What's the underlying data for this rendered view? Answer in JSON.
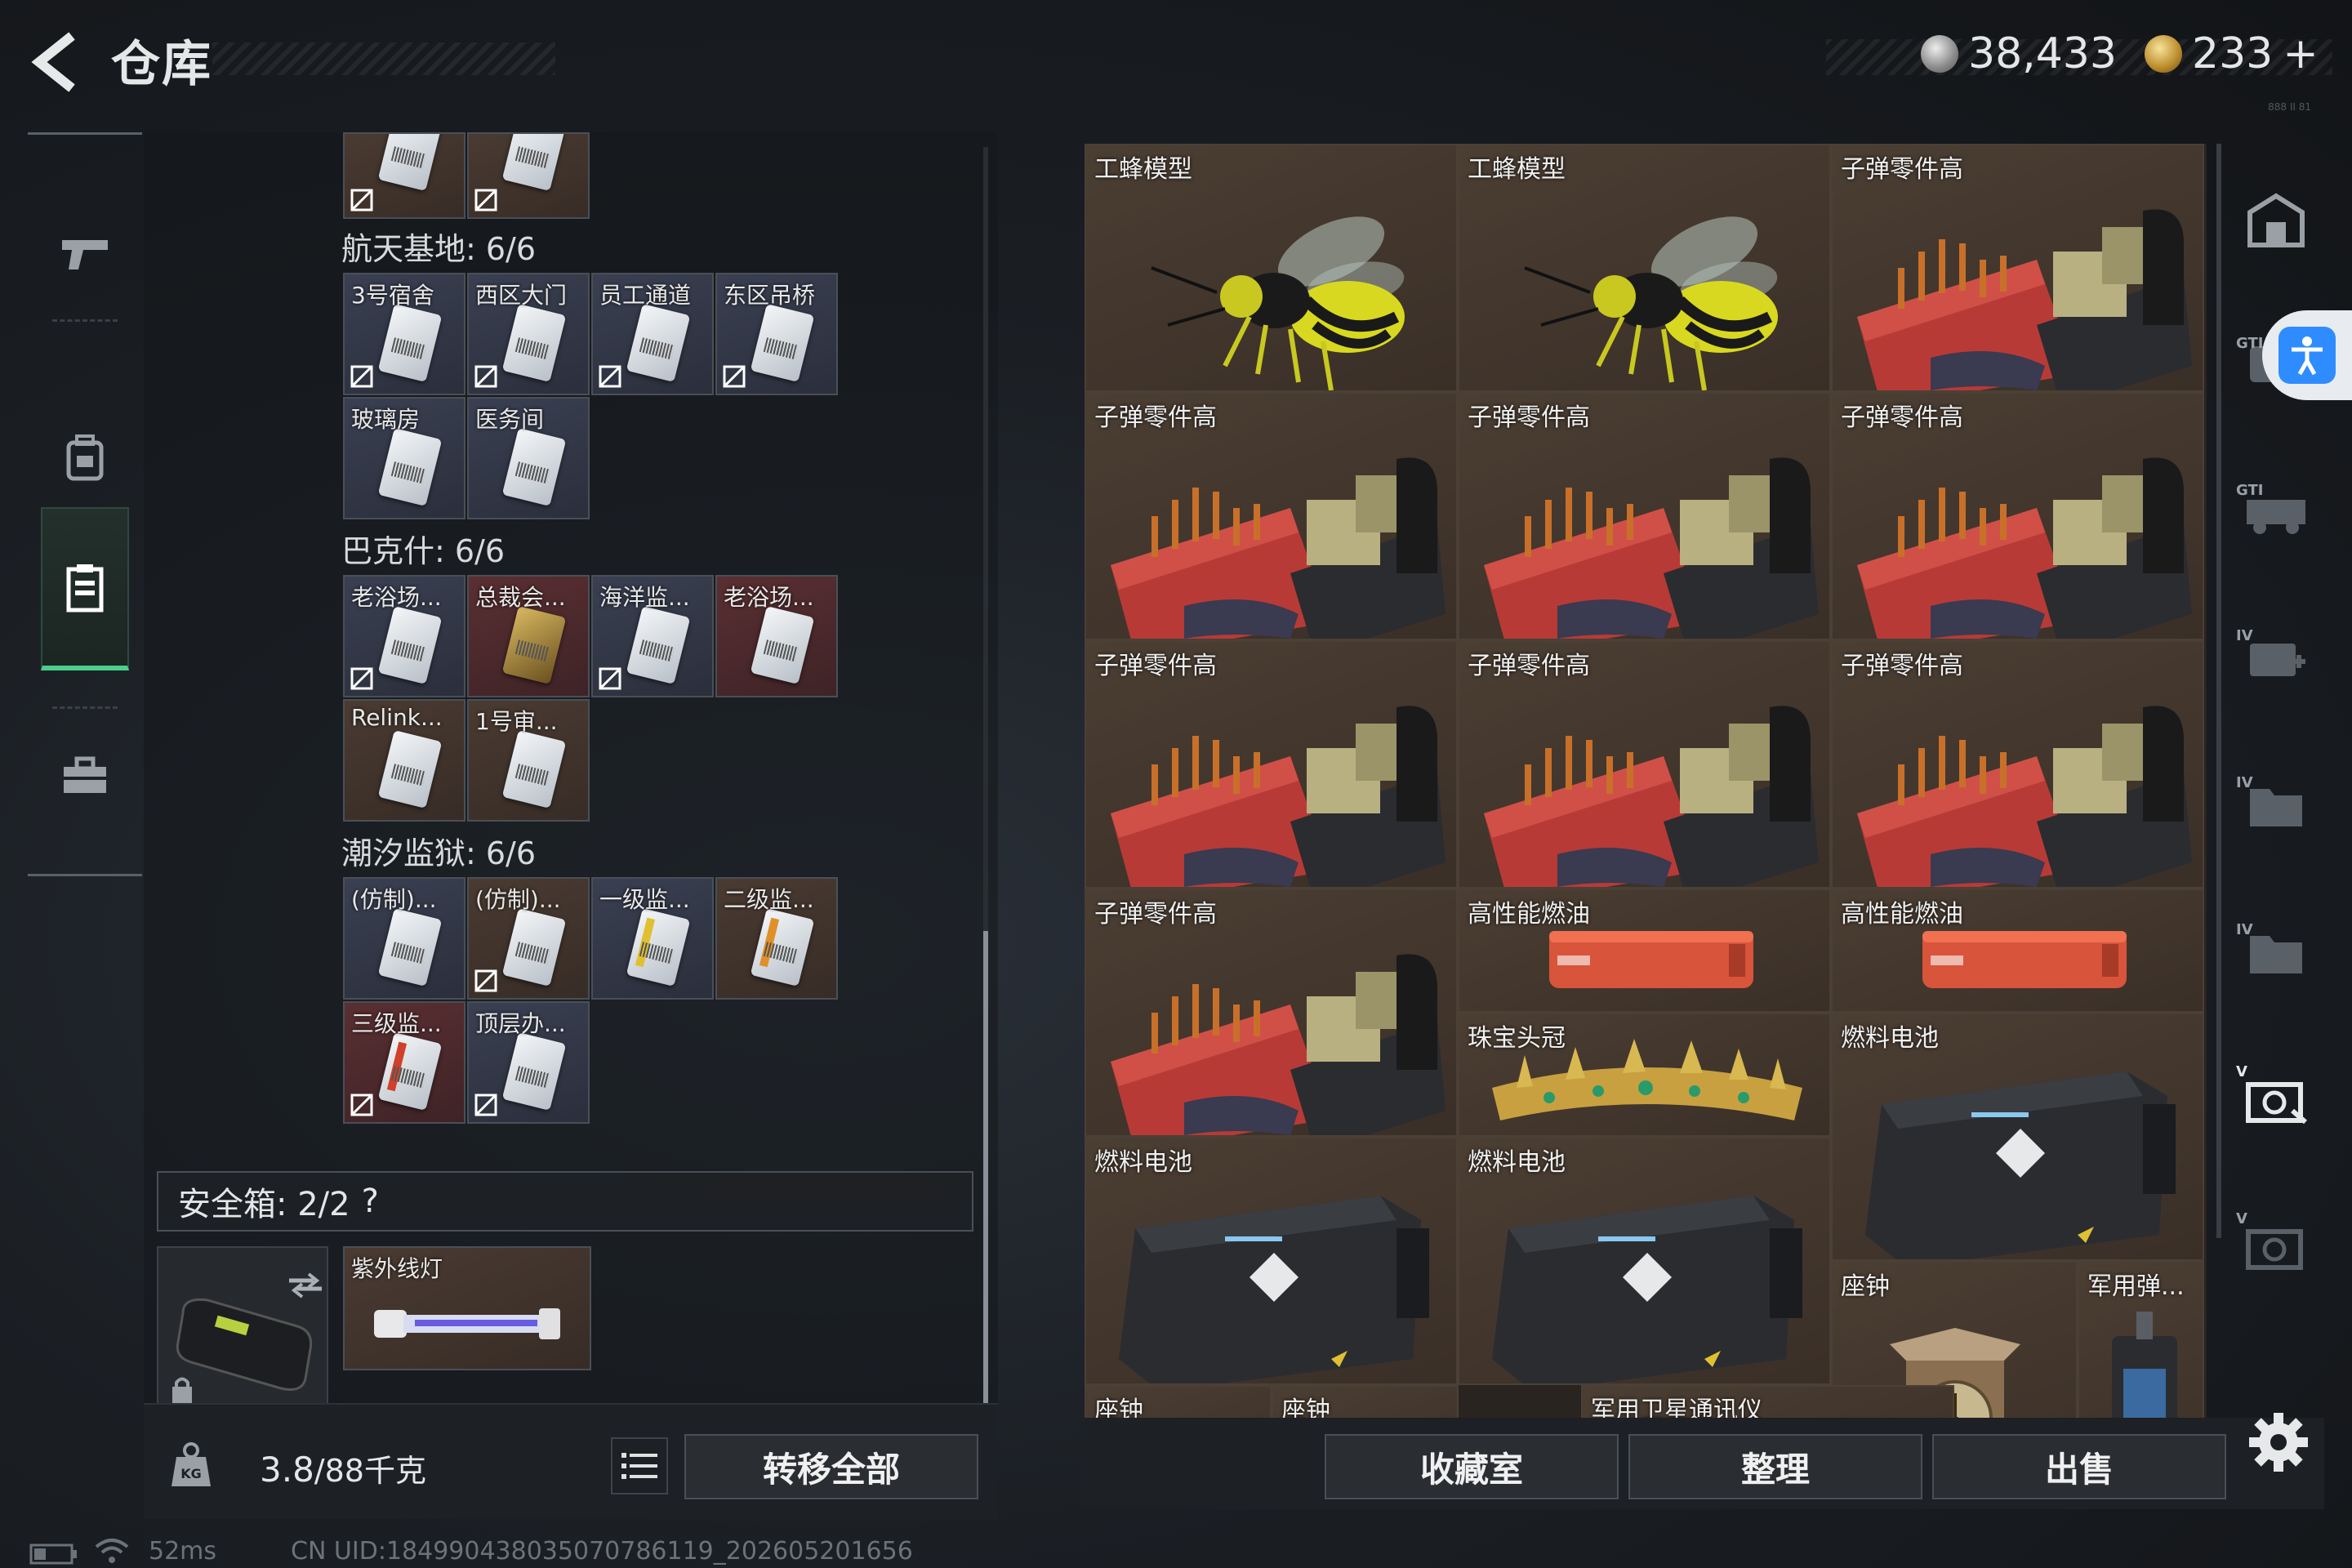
{
  "header": {
    "title": "仓库",
    "currency_silver": "38,433",
    "currency_gold": "233",
    "plus": "+",
    "tiny": "888 II 81"
  },
  "left_nav": {
    "items": [
      {
        "name": "weapons",
        "icon": "gun-icon"
      },
      {
        "name": "equipment",
        "icon": "backpack-icon"
      },
      {
        "name": "items",
        "icon": "clipboard-icon",
        "active": true
      },
      {
        "name": "tools",
        "icon": "toolbox-icon"
      }
    ]
  },
  "sections": [
    {
      "label": "航天基地: 6/6",
      "cards": [
        "3号宿舍",
        "西区大门",
        "员工通道",
        "东区吊桥",
        "玻璃房",
        "医务间"
      ]
    },
    {
      "label": "巴克什: 6/6",
      "cards": [
        "老浴场...",
        "总裁会...",
        "海洋监...",
        "老浴场...",
        "Relink...",
        "1号审..."
      ]
    },
    {
      "label": "潮汐监狱: 6/6",
      "cards": [
        "(仿制)...",
        "(仿制)...",
        "一级监...",
        "二级监...",
        "三级监...",
        "顶层办..."
      ]
    }
  ],
  "safe_box": {
    "label": "安全箱: 2/2",
    "help": "?",
    "item": "紫外线灯"
  },
  "bottom_left": {
    "weight": "3.8",
    "weight_max": "/88千克",
    "transfer_all": "转移全部"
  },
  "grid_items": [
    "工蜂模型",
    "工蜂模型",
    "子弹零件高",
    "子弹零件高",
    "子弹零件高",
    "子弹零件高",
    "子弹零件高",
    "子弹零件高",
    "子弹零件高",
    "子弹零件高",
    "高性能燃油",
    "高性能燃油",
    "珠宝头冠",
    "燃料电池",
    "燃料电池",
    "燃料电池",
    "座钟",
    "军用弹...",
    "座钟",
    "座钟",
    "军用卫星通讯仪"
  ],
  "grid_buttons": {
    "collection": "收藏室",
    "organize": "整理",
    "sell": "出售"
  },
  "right_nav": {
    "labels": [
      "GTI",
      "GTI",
      "IV",
      "IV",
      "IV",
      "V",
      "V"
    ]
  },
  "status": {
    "ping": "52ms",
    "uid": "CN UID:18499043803507078611​9_202605201656"
  },
  "colors": {
    "accent_green": "#49d08a",
    "access_blue": "#2f8cff"
  }
}
